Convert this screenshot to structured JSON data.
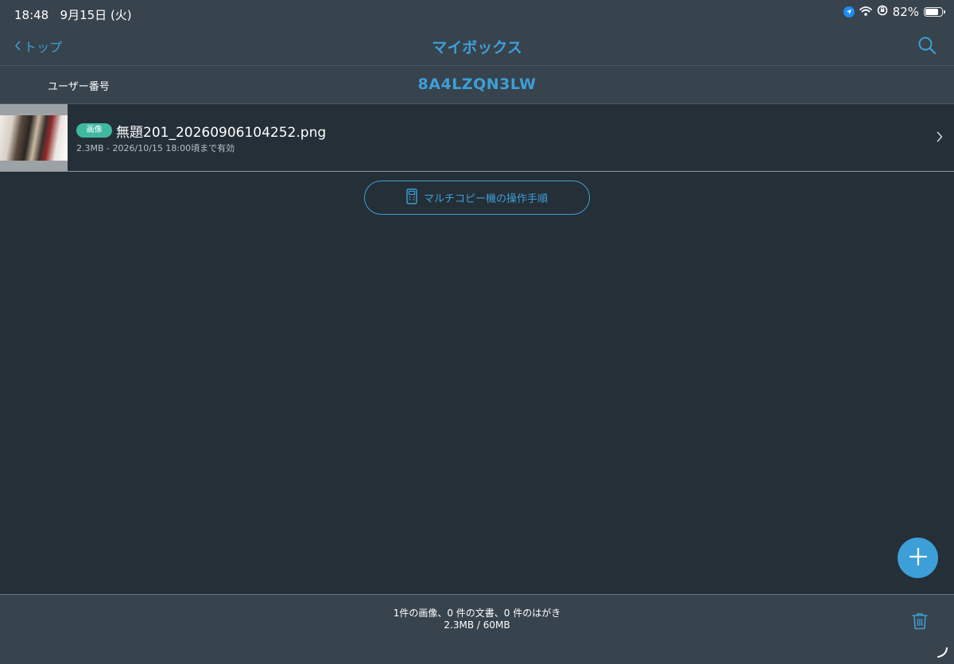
{
  "status_bar": {
    "time": "18:48",
    "date": "9月15日 (火)",
    "battery": "82%",
    "battery_level": 0.82,
    "icons": [
      "location-icon",
      "wifi-icon",
      "rotation-lock-icon",
      "battery-icon"
    ]
  },
  "nav": {
    "back_label": "トップ",
    "title": "マイボックス",
    "search_icon": "search-icon"
  },
  "user": {
    "label": "ユーザー番号",
    "id": "8A4LZQN3LW"
  },
  "files": [
    {
      "badge": "画像",
      "name": "無題201_20260906104252.png",
      "meta": "2.3MB - 2026/10/15 18:00頃まで有効"
    }
  ],
  "guide_button": {
    "label": "マルチコピー機の操作手順",
    "icon": "copier-icon"
  },
  "fab": {
    "icon": "plus-icon"
  },
  "footer": {
    "summary": "1件の画像、0 件の文書、0 件のはがき",
    "usage": "2.3MB / 60MB",
    "trash_icon": "trash-icon"
  },
  "colors": {
    "accent": "#3d9fd8",
    "badge": "#3fb8a2",
    "background": "#252f37",
    "bar": "#37434d"
  }
}
